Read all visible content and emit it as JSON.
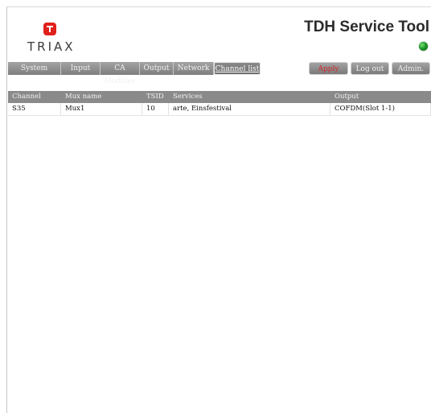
{
  "brand": {
    "logo_text": "TRIAX",
    "primary_color": "#e0201b"
  },
  "header": {
    "title": "TDH Service Tool",
    "status_color": "#1f9a2a"
  },
  "nav": {
    "tabs": [
      {
        "label": "System"
      },
      {
        "label": "Input"
      },
      {
        "label": "CA Modules"
      },
      {
        "label": "Output"
      },
      {
        "label": "Network"
      },
      {
        "label": "Channel list",
        "active": true
      }
    ]
  },
  "actions": {
    "apply": "Apply",
    "logout": "Log out",
    "admin": "Admin."
  },
  "table": {
    "columns": [
      "Channel",
      "Mux name",
      "TSID",
      "Services",
      "Output"
    ],
    "rows": [
      [
        "S35",
        "Mux1",
        "10",
        "arte, Einsfestival",
        "COFDM(Slot 1-1)"
      ]
    ]
  }
}
